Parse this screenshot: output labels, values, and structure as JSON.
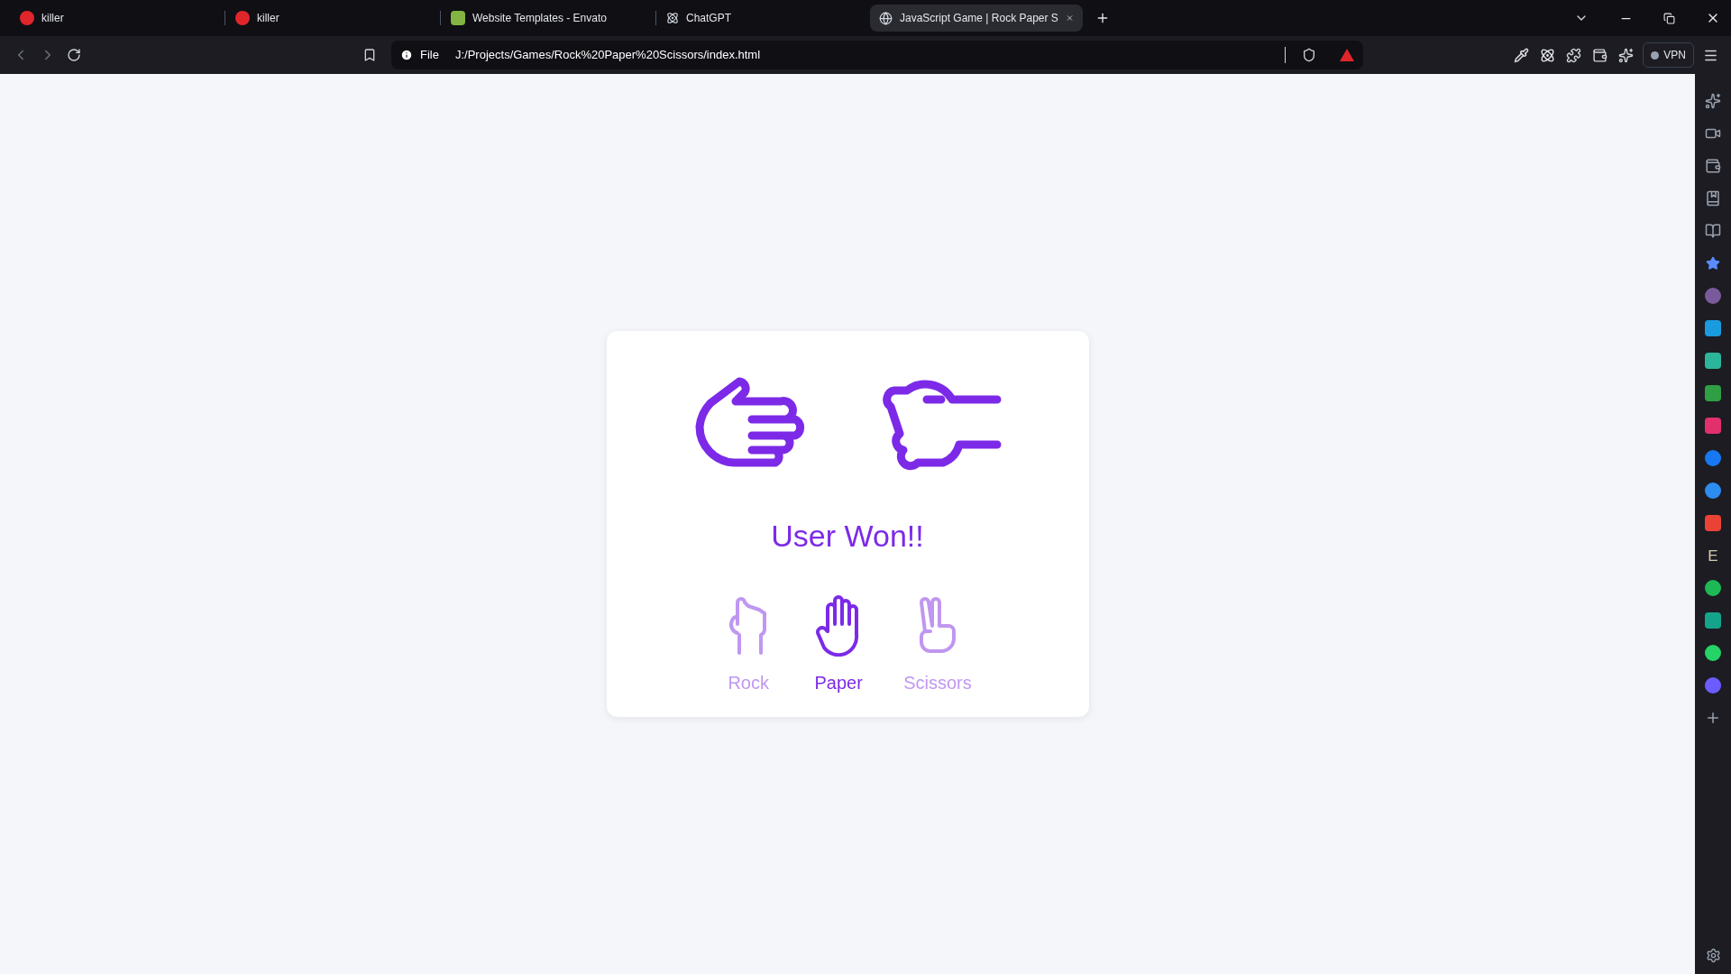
{
  "tabs": [
    {
      "label": "killer",
      "kind": "red",
      "selected": false
    },
    {
      "label": "killer",
      "kind": "red",
      "selected": false
    },
    {
      "label": "Website Templates - Envato",
      "kind": "envato",
      "selected": false
    },
    {
      "label": "ChatGPT",
      "kind": "chat",
      "selected": false
    },
    {
      "label": "JavaScript Game | Rock Paper S",
      "kind": "globe",
      "selected": true
    }
  ],
  "address_bar": {
    "scheme": "File",
    "url": "J:/Projects/Games/Rock%20Paper%20Scissors/index.html"
  },
  "vpn": {
    "label": "VPN"
  },
  "sidebar": {
    "items": [
      {
        "kind": "sparkle"
      },
      {
        "kind": "video"
      },
      {
        "kind": "wallet"
      },
      {
        "kind": "bookmark"
      },
      {
        "kind": "reader"
      },
      {
        "kind": "star"
      },
      {
        "kind": "avatar"
      },
      {
        "kind": "w"
      },
      {
        "kind": "p"
      },
      {
        "kind": "px"
      },
      {
        "kind": "insta"
      },
      {
        "kind": "fb"
      },
      {
        "kind": "c"
      },
      {
        "kind": "mail"
      },
      {
        "kind": "letter",
        "label": "E"
      },
      {
        "kind": "spotify"
      },
      {
        "kind": "thread"
      },
      {
        "kind": "whatsapp"
      },
      {
        "kind": "messenger"
      },
      {
        "kind": "add"
      }
    ]
  },
  "game": {
    "hands": [
      {
        "kind": "paper"
      },
      {
        "kind": "scissors"
      }
    ],
    "result": "User Won!!",
    "choices": [
      {
        "kind": "rock",
        "label": "Rock",
        "selected": false
      },
      {
        "kind": "paper",
        "label": "Paper",
        "selected": true
      },
      {
        "kind": "scissors",
        "label": "Scissors",
        "selected": false
      }
    ]
  }
}
